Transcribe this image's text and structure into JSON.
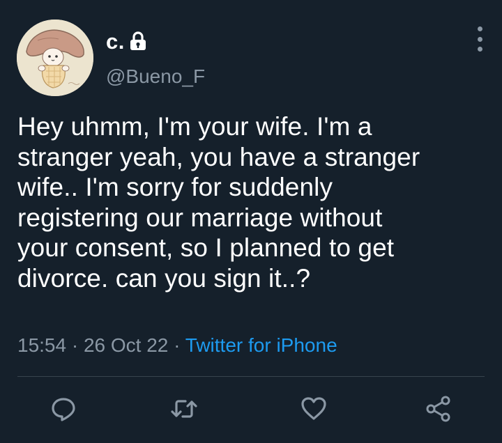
{
  "author": {
    "display_name": "c.",
    "handle": "@Bueno_F",
    "avatar_icon": "mushroom-character-avatar",
    "protected_icon": "lock-icon"
  },
  "tweet": {
    "text": "Hey uhmm, I'm your wife. I'm a\nstranger yeah, you have a stranger\nwife.. I'm sorry for suddenly\nregistering our marriage without\nyour consent, so I planned to get\ndivorce. can you sign it..?",
    "time": "15:54",
    "separator": "·",
    "date": "26 Oct 22",
    "source": "Twitter for iPhone"
  },
  "actions": {
    "reply_icon": "reply-icon",
    "retweet_icon": "retweet-icon",
    "like_icon": "heart-icon",
    "share_icon": "share-icon"
  },
  "colors": {
    "background": "#15202b",
    "text": "#ffffff",
    "secondary": "#8b98a5",
    "accent": "#1d9bf0",
    "divider": "#38444d"
  }
}
